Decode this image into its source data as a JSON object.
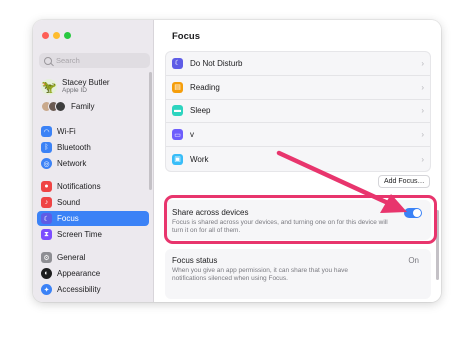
{
  "sidebar": {
    "search_placeholder": "Search",
    "user": {
      "name": "Stacey Butler",
      "sub": "Apple ID"
    },
    "family_label": "Family",
    "items": [
      {
        "label": "Wi-Fi",
        "icon": "wifi-icon",
        "color": "#3b82f6"
      },
      {
        "label": "Bluetooth",
        "icon": "bluetooth-icon",
        "color": "#3b82f6"
      },
      {
        "label": "Network",
        "icon": "network-icon",
        "color": "#3b82f6"
      },
      {
        "label": "Notifications",
        "icon": "bell-icon",
        "color": "#ef4444"
      },
      {
        "label": "Sound",
        "icon": "speaker-icon",
        "color": "#ef4444"
      },
      {
        "label": "Focus",
        "icon": "moon-icon",
        "color": "#5e5ce6"
      },
      {
        "label": "Screen Time",
        "icon": "hourglass-icon",
        "color": "#7c4dff"
      },
      {
        "label": "General",
        "icon": "gear-icon",
        "color": "#8e8e93"
      },
      {
        "label": "Appearance",
        "icon": "appearance-icon",
        "color": "#1d1d1f"
      },
      {
        "label": "Accessibility",
        "icon": "accessibility-icon",
        "color": "#3b82f6"
      }
    ]
  },
  "main": {
    "title": "Focus",
    "focus_modes": [
      {
        "label": "Do Not Disturb",
        "icon": "moon-icon",
        "color": "#5e5ce6"
      },
      {
        "label": "Reading",
        "icon": "book-icon",
        "color": "#f59e0b"
      },
      {
        "label": "Sleep",
        "icon": "bed-icon",
        "color": "#2dd4bf"
      },
      {
        "label": "v",
        "icon": "laptop-icon",
        "color": "#6d5dfc"
      },
      {
        "label": "Work",
        "icon": "badge-icon",
        "color": "#38bdf8"
      }
    ],
    "add_focus_label": "Add Focus…",
    "share": {
      "title": "Share across devices",
      "description": "Focus is shared across your devices, and turning one on for this device will turn it on for all of them.",
      "enabled": true
    },
    "status": {
      "title": "Focus status",
      "value": "On",
      "description": "When you give an app permission, it can share that you have notifications silenced when using Focus."
    }
  },
  "colors": {
    "accent": "#3b82f6",
    "highlight": "#e8356d"
  }
}
